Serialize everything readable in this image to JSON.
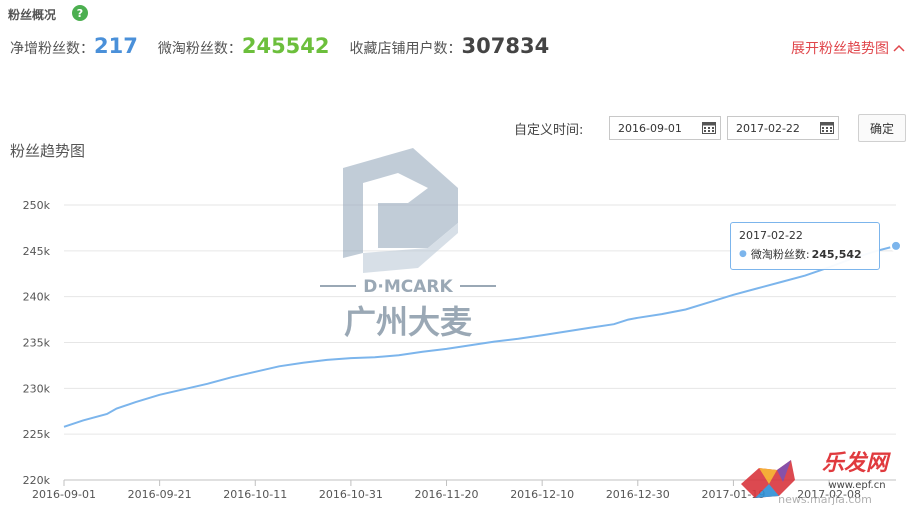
{
  "overview": {
    "title": "粉丝概况",
    "help_icon": "question-circle-icon",
    "stats": [
      {
        "label": "净增粉丝数：",
        "value": "217",
        "color": "#4a90d9"
      },
      {
        "label": "微淘粉丝数：",
        "value": "245542",
        "color": "#6cbf3c"
      },
      {
        "label": "收藏店铺用户数：",
        "value": "307834",
        "color": "#444444"
      }
    ],
    "expand_link": "展开粉丝趋势图"
  },
  "filter": {
    "custom_time_label": "自定义时间:",
    "start_date": "2016-09-01",
    "end_date": "2017-02-22",
    "confirm_label": "确定",
    "calendar_icon": "calendar-icon"
  },
  "watermark": {
    "brand": "D·MCARK",
    "name": "广州大麦"
  },
  "corner_logo": {
    "text": "乐发网",
    "url_text": "news.marjia.com",
    "domain_text": "www.epf.cn"
  },
  "tooltip": {
    "date": "2017-02-22",
    "series": "微淘粉丝数:",
    "value": "245,542"
  },
  "chart_data": {
    "type": "line",
    "title": "粉丝趋势图",
    "xlabel": "",
    "ylabel": "",
    "y_tick_labels": [
      "220k",
      "225k",
      "230k",
      "235k",
      "240k",
      "245k",
      "250k"
    ],
    "y_ticks": [
      220000,
      225000,
      230000,
      235000,
      240000,
      245000,
      250000
    ],
    "ylim": [
      220000,
      250000
    ],
    "x_tick_labels": [
      "2016-09-01",
      "2016-09-21",
      "2016-10-11",
      "2016-10-31",
      "2016-11-20",
      "2016-12-10",
      "2016-12-30",
      "2017-01-19",
      "2017-02-08"
    ],
    "xlim": [
      "2016-09-01",
      "2017-02-22"
    ],
    "grid": true,
    "color": "#7cb5ec",
    "series": [
      {
        "name": "微淘粉丝数",
        "x": [
          "2016-09-01",
          "2016-09-05",
          "2016-09-10",
          "2016-09-12",
          "2016-09-16",
          "2016-09-21",
          "2016-09-26",
          "2016-10-01",
          "2016-10-06",
          "2016-10-11",
          "2016-10-16",
          "2016-10-21",
          "2016-10-26",
          "2016-10-31",
          "2016-11-05",
          "2016-11-10",
          "2016-11-15",
          "2016-11-20",
          "2016-11-25",
          "2016-11-30",
          "2016-12-05",
          "2016-12-10",
          "2016-12-15",
          "2016-12-20",
          "2016-12-25",
          "2016-12-28",
          "2016-12-30",
          "2017-01-04",
          "2017-01-09",
          "2017-01-14",
          "2017-01-19",
          "2017-01-24",
          "2017-01-29",
          "2017-02-03",
          "2017-02-08",
          "2017-02-13",
          "2017-02-18",
          "2017-02-22"
        ],
        "values": [
          225800,
          226500,
          227200,
          227800,
          228500,
          229300,
          229900,
          230500,
          231200,
          231800,
          232400,
          232800,
          233100,
          233300,
          233400,
          233600,
          234000,
          234300,
          234700,
          235100,
          235400,
          235800,
          236200,
          236600,
          237000,
          237500,
          237700,
          238100,
          238600,
          239400,
          240200,
          240900,
          241600,
          242300,
          243200,
          244200,
          245000,
          245542
        ]
      }
    ]
  }
}
